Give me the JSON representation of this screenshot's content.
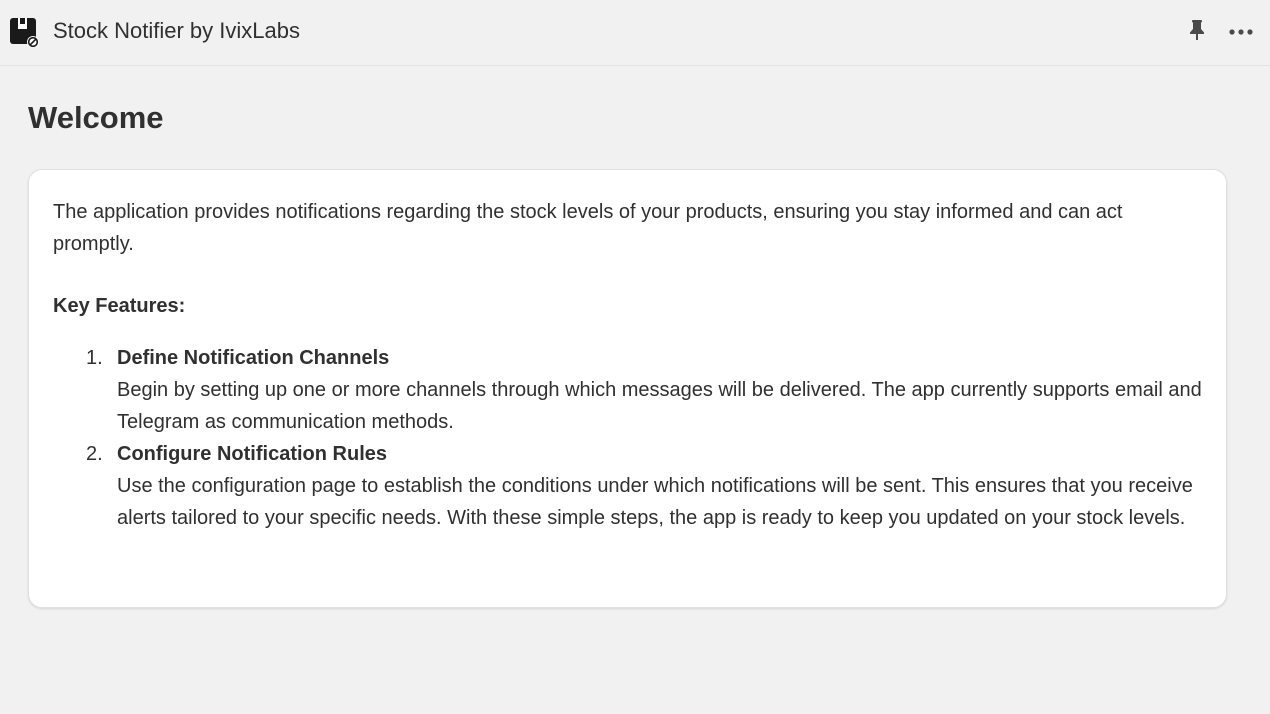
{
  "app": {
    "title": "Stock Notifier by IvixLabs",
    "icon": "stock-notifier-app-icon"
  },
  "toolbar": {
    "pin_icon": "pin-icon",
    "more_icon": "more-options-icon"
  },
  "page": {
    "title": "Welcome"
  },
  "card": {
    "intro": "The application provides notifications regarding the stock levels of your products, ensuring you stay informed and can act promptly.",
    "features_heading": "Key Features:",
    "features": [
      {
        "number": "1.",
        "title": "Define Notification Channels",
        "description": "Begin by setting up one or more channels through which messages will be delivered. The app currently supports email and Telegram as communication methods."
      },
      {
        "number": "2.",
        "title": "Configure Notification Rules",
        "description": "Use the configuration page to establish the conditions under which notifications will be sent. This ensures that you receive alerts tailored to your specific needs. With these simple steps, the app is ready to keep you updated on your stock levels."
      }
    ]
  },
  "colors": {
    "background": "#f1f1f1",
    "card": "#ffffff",
    "text": "#303030",
    "icon": "#1a1a1a"
  }
}
